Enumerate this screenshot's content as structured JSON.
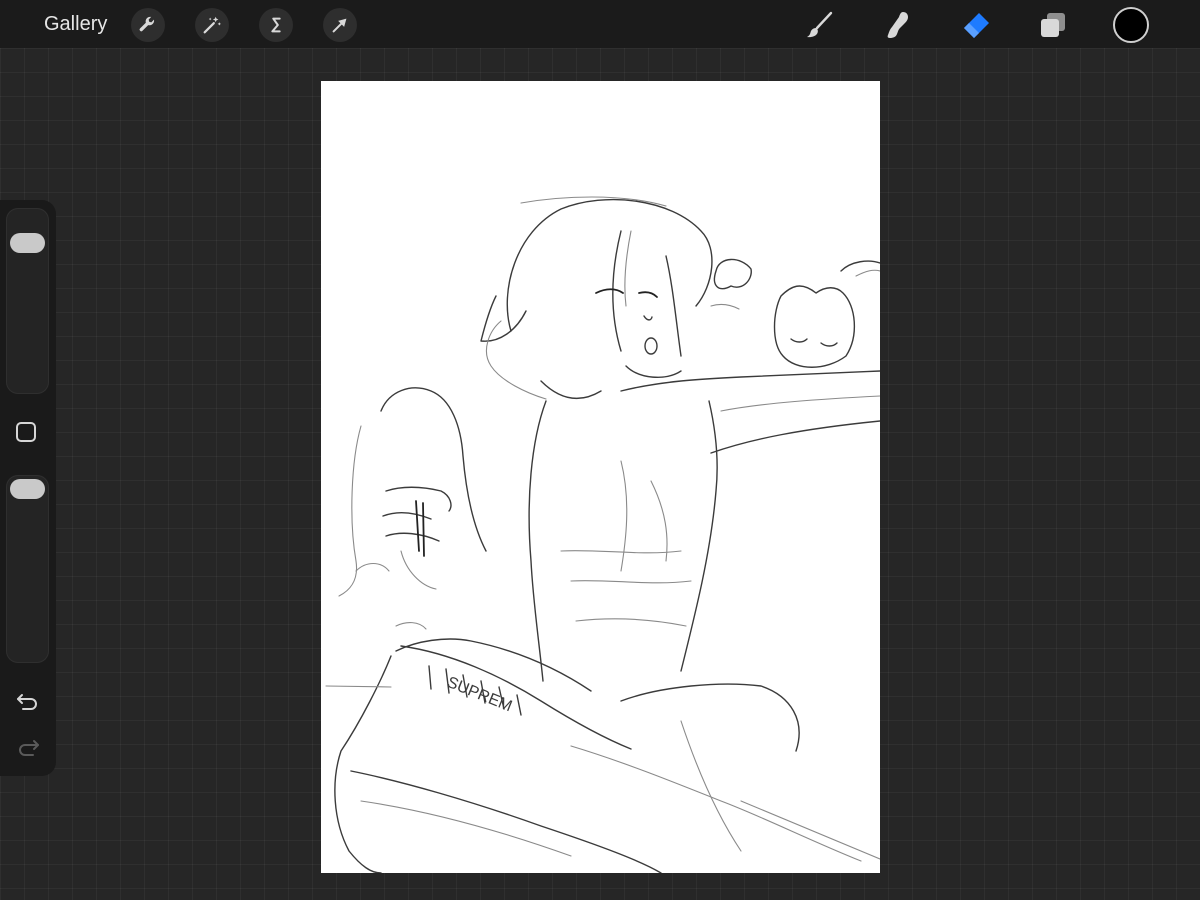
{
  "topbar": {
    "gallery_label": "Gallery",
    "left_tools": [
      {
        "name": "actions",
        "icon": "wrench-icon"
      },
      {
        "name": "adjustments",
        "icon": "magic-wand-icon"
      },
      {
        "name": "selection",
        "icon": "selection-s-icon"
      },
      {
        "name": "transform",
        "icon": "arrow-cursor-icon"
      }
    ],
    "right_tools": [
      {
        "name": "brush",
        "icon": "brush-icon",
        "active": false
      },
      {
        "name": "smudge",
        "icon": "smudge-finger-icon",
        "active": false
      },
      {
        "name": "eraser",
        "icon": "eraser-icon",
        "active": true
      },
      {
        "name": "layers",
        "icon": "layers-icon",
        "active": false
      }
    ],
    "current_color": "#000000",
    "active_tool_color": "#1e7bff"
  },
  "sidebar": {
    "brush_size_level": 0.91,
    "opacity_level": 1.0,
    "undo_icon": "undo-arrow-icon",
    "redo_icon": "redo-arrow-icon",
    "redo_enabled": false
  },
  "canvas": {
    "background": "#ffffff",
    "content": "pencil-sketch",
    "visible_lettering": "SUPREM"
  },
  "theme": {
    "background": "#262626",
    "toolbar": "#1b1b1b",
    "icon_color": "#d9d9d9"
  }
}
